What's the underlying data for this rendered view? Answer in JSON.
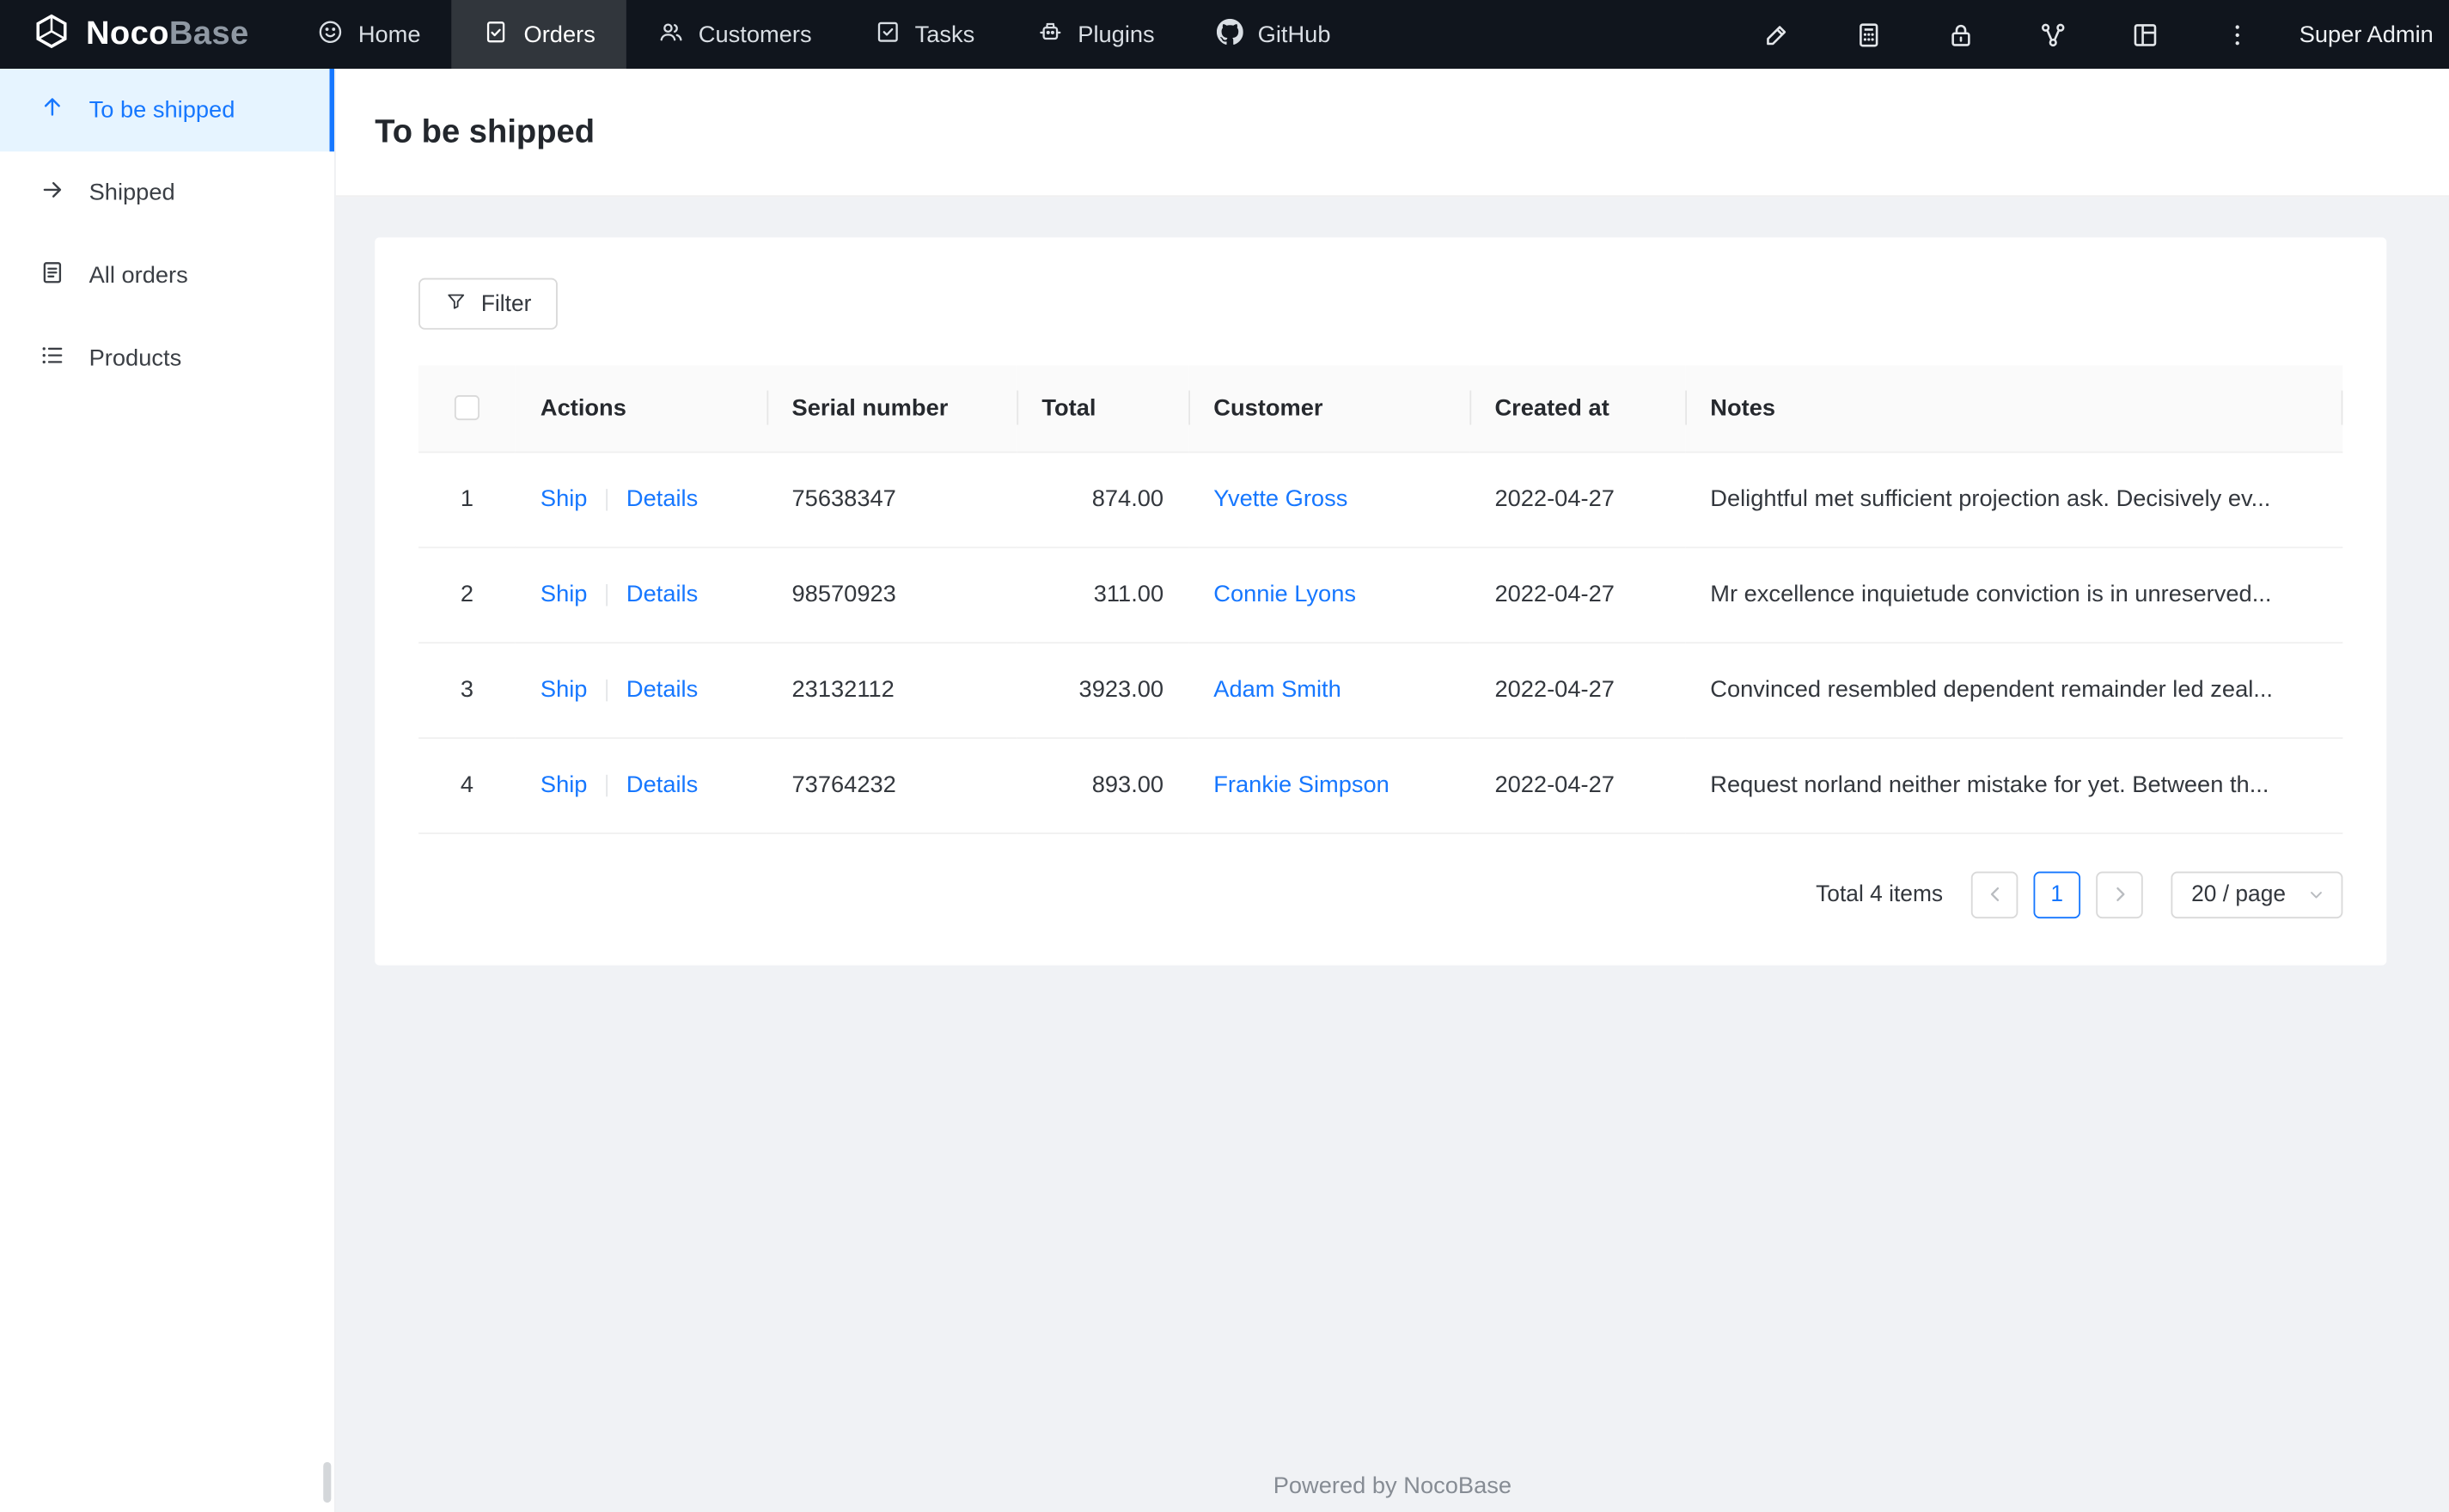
{
  "colors": {
    "accent": "#1677ff",
    "topnav_bg": "#10151d",
    "sidebar_active_bg": "#e6f4ff",
    "content_bg": "#f0f2f5",
    "link": "#1677ff"
  },
  "topnav": {
    "brand": {
      "bold": "Noco",
      "light": "Base"
    },
    "items": [
      {
        "label": "Home"
      },
      {
        "label": "Orders"
      },
      {
        "label": "Customers"
      },
      {
        "label": "Tasks"
      },
      {
        "label": "Plugins"
      },
      {
        "label": "GitHub"
      }
    ],
    "user_label": "Super Admin"
  },
  "sidebar": {
    "items": [
      {
        "label": "To be shipped"
      },
      {
        "label": "Shipped"
      },
      {
        "label": "All orders"
      },
      {
        "label": "Products"
      }
    ]
  },
  "page": {
    "title": "To be shipped"
  },
  "toolbar": {
    "filter_label": "Filter"
  },
  "table": {
    "columns": [
      "Actions",
      "Serial number",
      "Total",
      "Customer",
      "Created at",
      "Notes"
    ],
    "rows": [
      {
        "index": "1",
        "ship": "Ship",
        "details": "Details",
        "serial": "75638347",
        "total": "874.00",
        "customer": "Yvette Gross",
        "created_at": "2022-04-27",
        "notes": "Delightful met sufficient projection ask. Decisively ev..."
      },
      {
        "index": "2",
        "ship": "Ship",
        "details": "Details",
        "serial": "98570923",
        "total": "311.00",
        "customer": "Connie Lyons",
        "created_at": "2022-04-27",
        "notes": "Mr excellence inquietude conviction is in unreserved..."
      },
      {
        "index": "3",
        "ship": "Ship",
        "details": "Details",
        "serial": "23132112",
        "total": "3923.00",
        "customer": "Adam Smith",
        "created_at": "2022-04-27",
        "notes": "Convinced resembled dependent remainder led zeal..."
      },
      {
        "index": "4",
        "ship": "Ship",
        "details": "Details",
        "serial": "73764232",
        "total": "893.00",
        "customer": "Frankie Simpson",
        "created_at": "2022-04-27",
        "notes": "Request norland neither mistake for yet. Between th..."
      }
    ]
  },
  "pagination": {
    "total_label": "Total 4 items",
    "current_page": "1",
    "page_size": "20 / page"
  },
  "footer": {
    "text": "Powered by NocoBase"
  }
}
